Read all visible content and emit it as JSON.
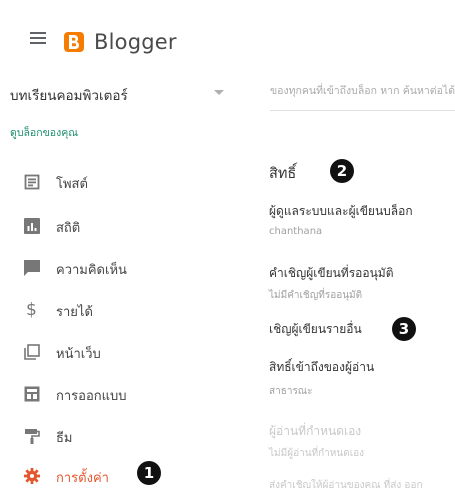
{
  "app": {
    "name": "Blogger"
  },
  "sidebar": {
    "blog_name": "บทเรียนคอมพิวเตอร์",
    "view_blog": "ดูบล็อกของคุณ",
    "items": [
      {
        "label": "โพสต์",
        "icon": "posts-icon"
      },
      {
        "label": "สถิติ",
        "icon": "stats-icon"
      },
      {
        "label": "ความคิดเห็น",
        "icon": "comments-icon"
      },
      {
        "label": "รายได้",
        "icon": "dollar-icon"
      },
      {
        "label": "หน้าเว็บ",
        "icon": "pages-icon"
      },
      {
        "label": "การออกแบบ",
        "icon": "layout-icon"
      },
      {
        "label": "ธีม",
        "icon": "paint-roller-icon"
      },
      {
        "label": "การตั้งค่า",
        "icon": "gear-icon",
        "active": true
      }
    ]
  },
  "settings": {
    "cut_text": "ของทุกคนที่เข้าถึงบล็อก หาก ค้นหาต่อได้",
    "section_title": "สิทธิ์",
    "rows": [
      {
        "label": "ผู้ดูแลระบบและผู้เขียนบล็อก",
        "value": "chanthana"
      },
      {
        "label": "คำเชิญผู้เขียนที่รออนุมัติ",
        "value": "ไม่มีคำเชิญที่รออนุมัติ"
      },
      {
        "label": "เชิญผู้เขียนรายอื่น"
      },
      {
        "label": "สิทธิ์เข้าถึงของผู้อ่าน",
        "value": "สาธารณะ"
      },
      {
        "label": "ผู้อ่านที่กำหนดเอง",
        "value": "ไม่มีผู้อ่านที่กำหนดเอง"
      },
      {
        "label": "ส่งคำเชิญให้ผู้อ่านของคุณ ที่ส่ง ออก"
      }
    ]
  },
  "annotations": {
    "one": "1",
    "two": "2",
    "three": "3"
  },
  "colors": {
    "accent": "#e4572e",
    "logo": "#f57c00",
    "link": "#1e8e6e"
  }
}
